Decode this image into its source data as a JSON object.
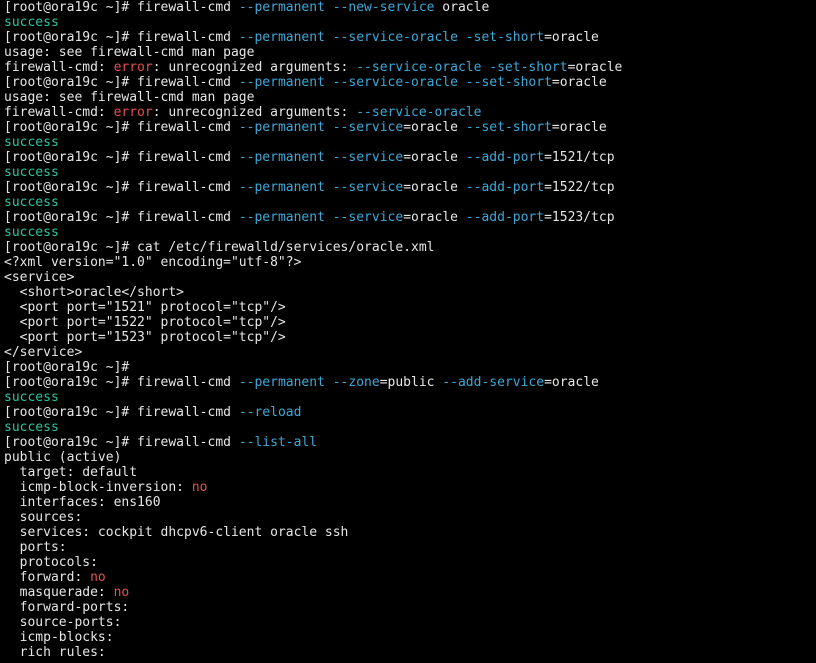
{
  "colors": {
    "background": "#000000",
    "default": "#e6e6e6",
    "option": "#3ea8d8",
    "success": "#2ec4a0",
    "error": "#e05252"
  },
  "lines": [
    {
      "segs": [
        [
          "[root@ora19c ~]# firewall-cmd ",
          "default"
        ],
        [
          "--permanent",
          "option"
        ],
        [
          " ",
          "default"
        ],
        [
          "--new-service",
          "option"
        ],
        [
          " oracle",
          "default"
        ]
      ]
    },
    {
      "segs": [
        [
          "success",
          "success"
        ]
      ]
    },
    {
      "segs": [
        [
          "[root@ora19c ~]# firewall-cmd ",
          "default"
        ],
        [
          "--permanent",
          "option"
        ],
        [
          " ",
          "default"
        ],
        [
          "--service-oracle",
          "option"
        ],
        [
          " ",
          "default"
        ],
        [
          "-set-short",
          "option"
        ],
        [
          "=oracle",
          "default"
        ]
      ]
    },
    {
      "segs": [
        [
          "usage: see firewall-cmd man page",
          "default"
        ]
      ]
    },
    {
      "segs": [
        [
          "firewall-cmd: ",
          "default"
        ],
        [
          "error",
          "error"
        ],
        [
          ": unrecognized arguments: ",
          "default"
        ],
        [
          "--service-oracle",
          "option"
        ],
        [
          " ",
          "default"
        ],
        [
          "-set-short",
          "option"
        ],
        [
          "=oracle",
          "default"
        ]
      ]
    },
    {
      "segs": [
        [
          "[root@ora19c ~]# firewall-cmd ",
          "default"
        ],
        [
          "--permanent",
          "option"
        ],
        [
          " ",
          "default"
        ],
        [
          "--service-oracle",
          "option"
        ],
        [
          " ",
          "default"
        ],
        [
          "--set-short",
          "option"
        ],
        [
          "=oracle",
          "default"
        ]
      ]
    },
    {
      "segs": [
        [
          "usage: see firewall-cmd man page",
          "default"
        ]
      ]
    },
    {
      "segs": [
        [
          "firewall-cmd: ",
          "default"
        ],
        [
          "error",
          "error"
        ],
        [
          ": unrecognized arguments: ",
          "default"
        ],
        [
          "--service-oracle",
          "option"
        ]
      ]
    },
    {
      "segs": [
        [
          "[root@ora19c ~]# firewall-cmd ",
          "default"
        ],
        [
          "--permanent",
          "option"
        ],
        [
          " ",
          "default"
        ],
        [
          "--service",
          "option"
        ],
        [
          "=oracle ",
          "default"
        ],
        [
          "--set-short",
          "option"
        ],
        [
          "=oracle",
          "default"
        ]
      ]
    },
    {
      "segs": [
        [
          "success",
          "success"
        ]
      ]
    },
    {
      "segs": [
        [
          "[root@ora19c ~]# firewall-cmd ",
          "default"
        ],
        [
          "--permanent",
          "option"
        ],
        [
          " ",
          "default"
        ],
        [
          "--service",
          "option"
        ],
        [
          "=oracle ",
          "default"
        ],
        [
          "--add-port",
          "option"
        ],
        [
          "=1521/tcp",
          "default"
        ]
      ]
    },
    {
      "segs": [
        [
          "success",
          "success"
        ]
      ]
    },
    {
      "segs": [
        [
          "[root@ora19c ~]# firewall-cmd ",
          "default"
        ],
        [
          "--permanent",
          "option"
        ],
        [
          " ",
          "default"
        ],
        [
          "--service",
          "option"
        ],
        [
          "=oracle ",
          "default"
        ],
        [
          "--add-port",
          "option"
        ],
        [
          "=1522/tcp",
          "default"
        ]
      ]
    },
    {
      "segs": [
        [
          "success",
          "success"
        ]
      ]
    },
    {
      "segs": [
        [
          "[root@ora19c ~]# firewall-cmd ",
          "default"
        ],
        [
          "--permanent",
          "option"
        ],
        [
          " ",
          "default"
        ],
        [
          "--service",
          "option"
        ],
        [
          "=oracle ",
          "default"
        ],
        [
          "--add-port",
          "option"
        ],
        [
          "=1523/tcp",
          "default"
        ]
      ]
    },
    {
      "segs": [
        [
          "success",
          "success"
        ]
      ]
    },
    {
      "segs": [
        [
          "[root@ora19c ~]# cat /etc/firewalld/services/oracle.xml",
          "default"
        ]
      ]
    },
    {
      "segs": [
        [
          "<?xml version=\"1.0\" encoding=\"utf-8\"?>",
          "default"
        ]
      ]
    },
    {
      "segs": [
        [
          "<service>",
          "default"
        ]
      ]
    },
    {
      "segs": [
        [
          "  <short>oracle</short>",
          "default"
        ]
      ]
    },
    {
      "segs": [
        [
          "  <port port=\"1521\" protocol=\"tcp\"/>",
          "default"
        ]
      ]
    },
    {
      "segs": [
        [
          "  <port port=\"1522\" protocol=\"tcp\"/>",
          "default"
        ]
      ]
    },
    {
      "segs": [
        [
          "  <port port=\"1523\" protocol=\"tcp\"/>",
          "default"
        ]
      ]
    },
    {
      "segs": [
        [
          "</service>",
          "default"
        ]
      ]
    },
    {
      "segs": [
        [
          "[root@ora19c ~]#",
          "default"
        ]
      ]
    },
    {
      "segs": [
        [
          "[root@ora19c ~]# firewall-cmd ",
          "default"
        ],
        [
          "--permanent",
          "option"
        ],
        [
          " ",
          "default"
        ],
        [
          "--zone",
          "option"
        ],
        [
          "=public ",
          "default"
        ],
        [
          "--add-service",
          "option"
        ],
        [
          "=oracle",
          "default"
        ]
      ]
    },
    {
      "segs": [
        [
          "success",
          "success"
        ]
      ]
    },
    {
      "segs": [
        [
          "[root@ora19c ~]# firewall-cmd ",
          "default"
        ],
        [
          "--reload",
          "option"
        ]
      ]
    },
    {
      "segs": [
        [
          "success",
          "success"
        ]
      ]
    },
    {
      "segs": [
        [
          "[root@ora19c ~]# firewall-cmd ",
          "default"
        ],
        [
          "--list-all",
          "option"
        ]
      ]
    },
    {
      "segs": [
        [
          "public (active)",
          "default"
        ]
      ]
    },
    {
      "segs": [
        [
          "  target: default",
          "default"
        ]
      ]
    },
    {
      "segs": [
        [
          "  icmp-block-inversion: ",
          "default"
        ],
        [
          "no",
          "error"
        ]
      ]
    },
    {
      "segs": [
        [
          "  interfaces: ens160",
          "default"
        ]
      ]
    },
    {
      "segs": [
        [
          "  sources:",
          "default"
        ]
      ]
    },
    {
      "segs": [
        [
          "  services: cockpit dhcpv6-client oracle ssh",
          "default"
        ]
      ]
    },
    {
      "segs": [
        [
          "  ports:",
          "default"
        ]
      ]
    },
    {
      "segs": [
        [
          "  protocols:",
          "default"
        ]
      ]
    },
    {
      "segs": [
        [
          "  forward: ",
          "default"
        ],
        [
          "no",
          "error"
        ]
      ]
    },
    {
      "segs": [
        [
          "  masquerade: ",
          "default"
        ],
        [
          "no",
          "error"
        ]
      ]
    },
    {
      "segs": [
        [
          "  forward-ports:",
          "default"
        ]
      ]
    },
    {
      "segs": [
        [
          "  source-ports:",
          "default"
        ]
      ]
    },
    {
      "segs": [
        [
          "  icmp-blocks:",
          "default"
        ]
      ]
    },
    {
      "segs": [
        [
          "  rich rules:",
          "default"
        ]
      ]
    }
  ]
}
